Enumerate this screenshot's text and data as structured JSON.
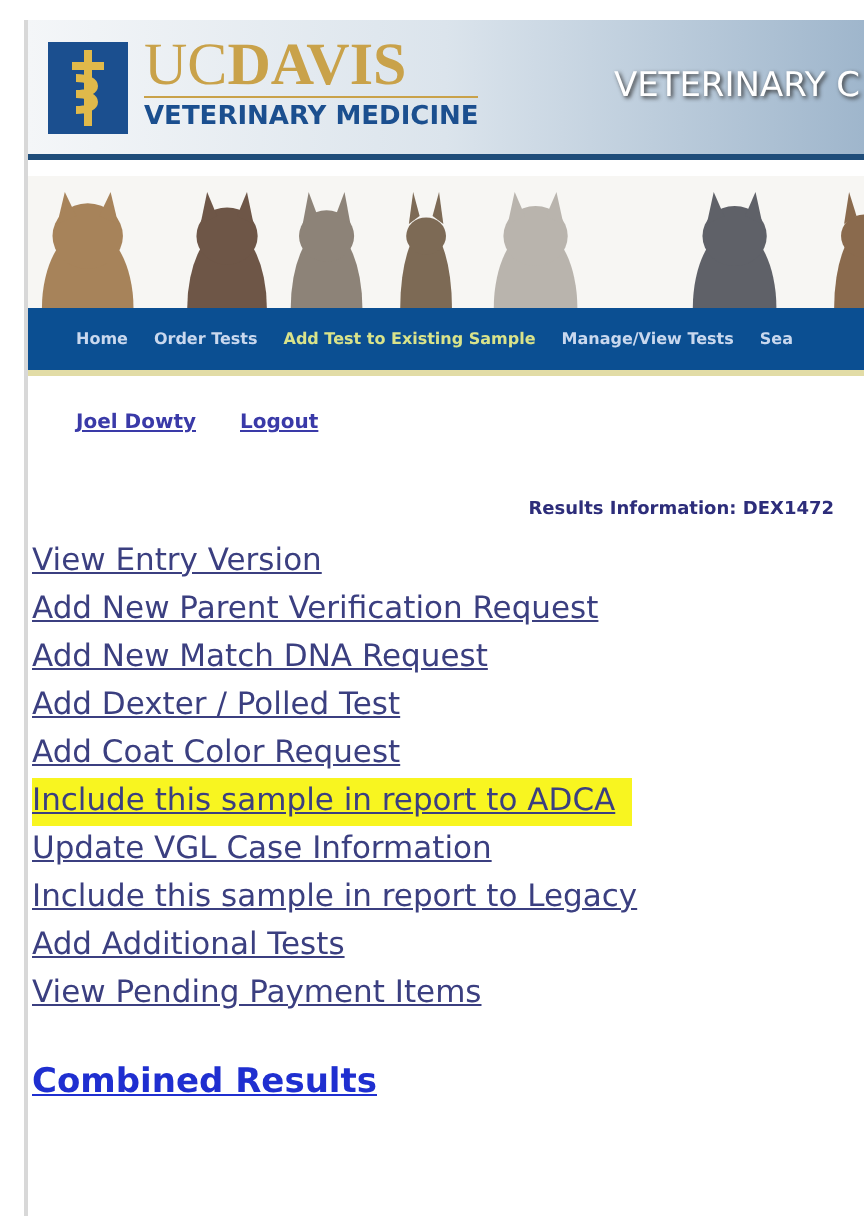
{
  "header": {
    "logo_top": "UC**DAVIS**",
    "logo_bottom": "VETERINARY MEDICINE",
    "title": "VETERINARY C"
  },
  "nav": [
    {
      "label": "Home",
      "selected": false
    },
    {
      "label": "Order Tests",
      "selected": false
    },
    {
      "label": "Add Test to Existing Sample",
      "selected": true
    },
    {
      "label": "Manage/View Tests",
      "selected": false
    },
    {
      "label": "Sea",
      "selected": false
    }
  ],
  "user_links": [
    "Joel Dowty",
    "Logout"
  ],
  "results_info": "Results Information: DEX1472",
  "actions": [
    {
      "label": "View Entry Version",
      "highlighted": false
    },
    {
      "label": "Add New Parent Verification Request",
      "highlighted": false
    },
    {
      "label": "Add New Match DNA Request",
      "highlighted": false
    },
    {
      "label": "Add Dexter / Polled Test",
      "highlighted": false
    },
    {
      "label": "Add Coat Color Request",
      "highlighted": false
    },
    {
      "label": "Include this sample in report to ADCA",
      "highlighted": true
    },
    {
      "label": "Update VGL Case Information",
      "highlighted": false
    },
    {
      "label": "Include this sample in report to Legacy",
      "highlighted": false
    },
    {
      "label": "Add Additional Tests",
      "highlighted": false
    },
    {
      "label": "View Pending Payment Items",
      "highlighted": false
    }
  ],
  "section_heading": "Combined Results"
}
